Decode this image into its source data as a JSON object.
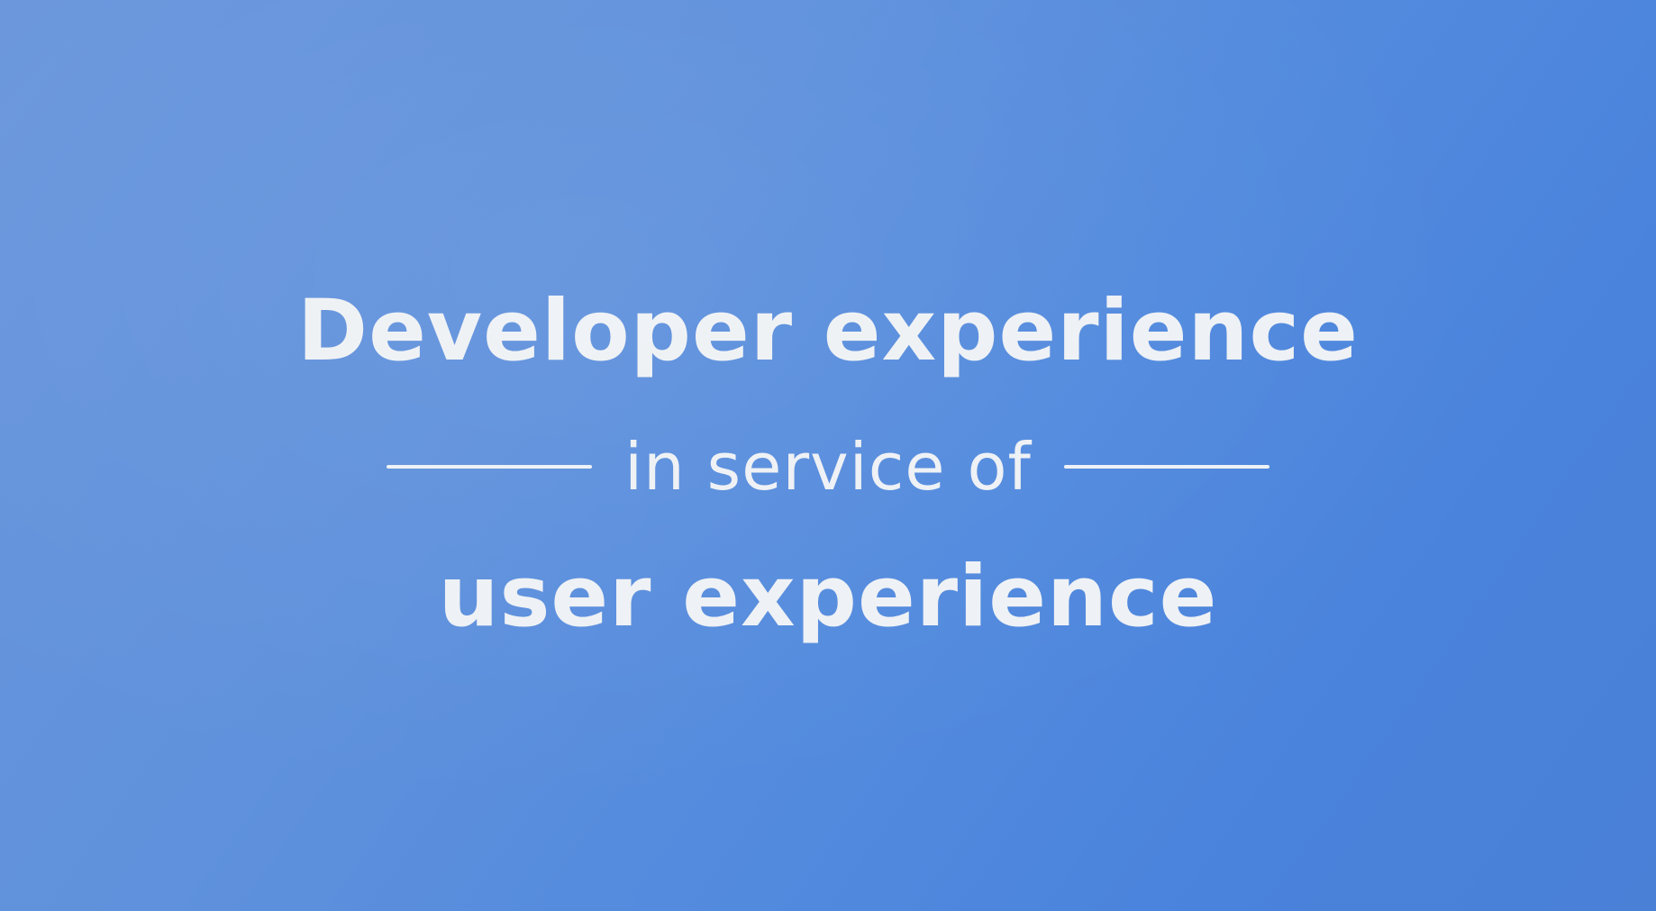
{
  "slide": {
    "headline": "Developer experience",
    "connector": "in service of",
    "closing": "user experience"
  },
  "colors": {
    "background_start": "#6a96dc",
    "background_end": "#4a80d6",
    "text": "#eef1f5"
  }
}
